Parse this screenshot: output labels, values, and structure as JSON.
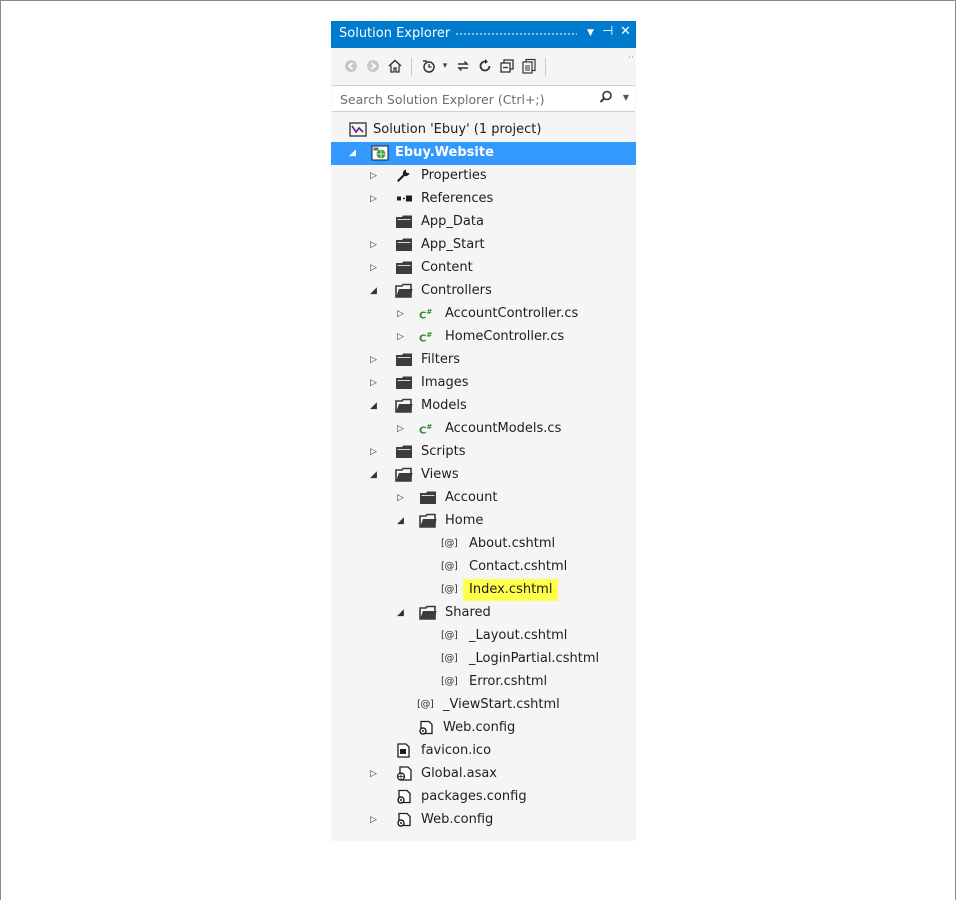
{
  "panel": {
    "title": "Solution Explorer",
    "controls": [
      "▼",
      "⊣",
      "✕"
    ]
  },
  "toolbar": {
    "buttons": [
      "back-icon",
      "forward-icon",
      "home-icon",
      "pending-changes-icon",
      "sync-icon",
      "refresh-icon",
      "collapse-all-icon",
      "show-all-files-icon"
    ],
    "more": "··"
  },
  "search": {
    "placeholder": "Search Solution Explorer (Ctrl+;)",
    "value": ""
  },
  "tree": [
    {
      "label": "Solution 'Ebuy' (1 project)",
      "level": 0,
      "arrow": "",
      "icon": "solution-icon"
    },
    {
      "label": "Ebuy.Website",
      "level": 0,
      "arrow": "◢",
      "icon": "web-project-icon",
      "selected": true
    },
    {
      "label": "Properties",
      "level": 1,
      "arrow": "▷",
      "icon": "wrench-icon"
    },
    {
      "label": "References",
      "level": 1,
      "arrow": "▷",
      "icon": "references-icon"
    },
    {
      "label": "App_Data",
      "level": 1,
      "arrow": "",
      "icon": "folder-icon"
    },
    {
      "label": "App_Start",
      "level": 1,
      "arrow": "▷",
      "icon": "folder-icon"
    },
    {
      "label": "Content",
      "level": 1,
      "arrow": "▷",
      "icon": "folder-icon"
    },
    {
      "label": "Controllers",
      "level": 1,
      "arrow": "◢",
      "icon": "folder-open-icon"
    },
    {
      "label": "AccountController.cs",
      "level": 2,
      "arrow": "▷",
      "icon": "csharp-icon"
    },
    {
      "label": "HomeController.cs",
      "level": 2,
      "arrow": "▷",
      "icon": "csharp-icon"
    },
    {
      "label": "Filters",
      "level": 1,
      "arrow": "▷",
      "icon": "folder-icon"
    },
    {
      "label": "Images",
      "level": 1,
      "arrow": "▷",
      "icon": "folder-icon"
    },
    {
      "label": "Models",
      "level": 1,
      "arrow": "◢",
      "icon": "folder-open-icon"
    },
    {
      "label": "AccountModels.cs",
      "level": 2,
      "arrow": "▷",
      "icon": "csharp-icon"
    },
    {
      "label": "Scripts",
      "level": 1,
      "arrow": "▷",
      "icon": "folder-icon"
    },
    {
      "label": "Views",
      "level": 1,
      "arrow": "◢",
      "icon": "folder-open-icon"
    },
    {
      "label": "Account",
      "level": 2,
      "arrow": "▷",
      "icon": "folder-icon"
    },
    {
      "label": "Home",
      "level": 2,
      "arrow": "◢",
      "icon": "folder-open-icon"
    },
    {
      "label": "About.cshtml",
      "level": 3,
      "arrow": "",
      "icon": "cshtml-icon"
    },
    {
      "label": "Contact.cshtml",
      "level": 3,
      "arrow": "",
      "icon": "cshtml-icon"
    },
    {
      "label": "Index.cshtml",
      "level": 3,
      "arrow": "",
      "icon": "cshtml-icon",
      "highlighted": true
    },
    {
      "label": "Shared",
      "level": 2,
      "arrow": "◢",
      "icon": "folder-open-icon"
    },
    {
      "label": "_Layout.cshtml",
      "level": 3,
      "arrow": "",
      "icon": "cshtml-icon"
    },
    {
      "label": "_LoginPartial.cshtml",
      "level": 3,
      "arrow": "",
      "icon": "cshtml-icon"
    },
    {
      "label": "Error.cshtml",
      "level": 3,
      "arrow": "",
      "icon": "cshtml-icon"
    },
    {
      "label": "_ViewStart.cshtml",
      "level": 2,
      "arrow": "",
      "icon": "cshtml-icon"
    },
    {
      "label": "Web.config",
      "level": 2,
      "arrow": "",
      "icon": "config-icon"
    },
    {
      "label": "favicon.ico",
      "level": 1,
      "arrow": "",
      "icon": "image-file-icon"
    },
    {
      "label": "Global.asax",
      "level": 1,
      "arrow": "▷",
      "icon": "global-asax-icon"
    },
    {
      "label": "packages.config",
      "level": 1,
      "arrow": "",
      "icon": "config-icon"
    },
    {
      "label": "Web.config",
      "level": 1,
      "arrow": "▷",
      "icon": "config-icon"
    }
  ],
  "colors": {
    "title_bar": "#007acc",
    "selection": "#3399ff",
    "highlight": "#ffff4d",
    "csharp": "#2e8b2e"
  }
}
